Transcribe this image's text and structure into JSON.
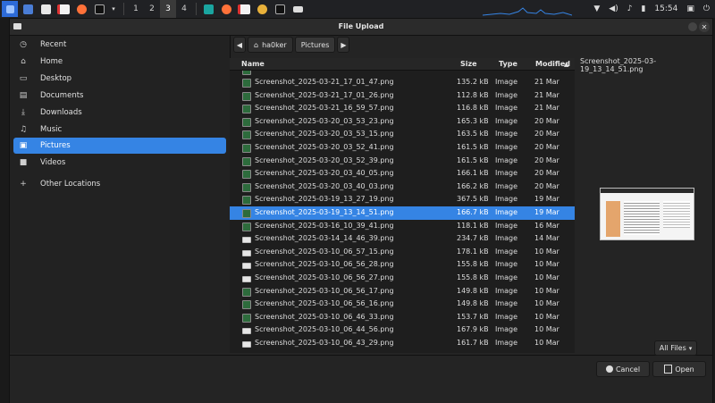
{
  "taskbar": {
    "workspaces": [
      "1",
      "2",
      "3",
      "4"
    ],
    "clock": "15:54"
  },
  "dialog": {
    "title": "File Upload"
  },
  "sidebar": {
    "items": [
      {
        "label": "Recent",
        "icon": "clock-icon"
      },
      {
        "label": "Home",
        "icon": "home-icon"
      },
      {
        "label": "Desktop",
        "icon": "desktop-icon"
      },
      {
        "label": "Documents",
        "icon": "document-icon"
      },
      {
        "label": "Downloads",
        "icon": "download-icon"
      },
      {
        "label": "Music",
        "icon": "music-icon"
      },
      {
        "label": "Pictures",
        "icon": "pictures-icon"
      },
      {
        "label": "Videos",
        "icon": "video-icon"
      },
      {
        "label": "Other Locations",
        "icon": "plus-icon"
      }
    ]
  },
  "path": {
    "home": "ha0ker",
    "current": "Pictures"
  },
  "columns": {
    "name": "Name",
    "size": "Size",
    "type": "Type",
    "modified": "Modified"
  },
  "files": [
    {
      "name": "Screenshot_2025-03-21_17_01_47.png",
      "size": "135.2 kB",
      "type": "Image",
      "modified": "21 Mar"
    },
    {
      "name": "Screenshot_2025-03-21_17_01_26.png",
      "size": "112.8 kB",
      "type": "Image",
      "modified": "21 Mar"
    },
    {
      "name": "Screenshot_2025-03-21_16_59_57.png",
      "size": "116.8 kB",
      "type": "Image",
      "modified": "21 Mar"
    },
    {
      "name": "Screenshot_2025-03-20_03_53_23.png",
      "size": "165.3 kB",
      "type": "Image",
      "modified": "20 Mar"
    },
    {
      "name": "Screenshot_2025-03-20_03_53_15.png",
      "size": "163.5 kB",
      "type": "Image",
      "modified": "20 Mar"
    },
    {
      "name": "Screenshot_2025-03-20_03_52_41.png",
      "size": "161.5 kB",
      "type": "Image",
      "modified": "20 Mar"
    },
    {
      "name": "Screenshot_2025-03-20_03_52_39.png",
      "size": "161.5 kB",
      "type": "Image",
      "modified": "20 Mar"
    },
    {
      "name": "Screenshot_2025-03-20_03_40_05.png",
      "size": "166.1 kB",
      "type": "Image",
      "modified": "20 Mar"
    },
    {
      "name": "Screenshot_2025-03-20_03_40_03.png",
      "size": "166.2 kB",
      "type": "Image",
      "modified": "20 Mar"
    },
    {
      "name": "Screenshot_2025-03-19_13_27_19.png",
      "size": "367.5 kB",
      "type": "Image",
      "modified": "19 Mar"
    },
    {
      "name": "Screenshot_2025-03-19_13_14_51.png",
      "size": "166.7 kB",
      "type": "Image",
      "modified": "19 Mar"
    },
    {
      "name": "Screenshot_2025-03-16_10_39_41.png",
      "size": "118.1 kB",
      "type": "Image",
      "modified": "16 Mar"
    },
    {
      "name": "Screenshot_2025-03-14_14_46_39.png",
      "size": "234.7 kB",
      "type": "Image",
      "modified": "14 Mar"
    },
    {
      "name": "Screenshot_2025-03-10_06_57_15.png",
      "size": "178.1 kB",
      "type": "Image",
      "modified": "10 Mar"
    },
    {
      "name": "Screenshot_2025-03-10_06_56_28.png",
      "size": "155.8 kB",
      "type": "Image",
      "modified": "10 Mar"
    },
    {
      "name": "Screenshot_2025-03-10_06_56_27.png",
      "size": "155.8 kB",
      "type": "Image",
      "modified": "10 Mar"
    },
    {
      "name": "Screenshot_2025-03-10_06_56_17.png",
      "size": "149.8 kB",
      "type": "Image",
      "modified": "10 Mar"
    },
    {
      "name": "Screenshot_2025-03-10_06_56_16.png",
      "size": "149.8 kB",
      "type": "Image",
      "modified": "10 Mar"
    },
    {
      "name": "Screenshot_2025-03-10_06_46_33.png",
      "size": "153.7 kB",
      "type": "Image",
      "modified": "10 Mar"
    },
    {
      "name": "Screenshot_2025-03-10_06_44_56.png",
      "size": "167.9 kB",
      "type": "Image",
      "modified": "10 Mar"
    },
    {
      "name": "Screenshot_2025-03-10_06_43_29.png",
      "size": "161.7 kB",
      "type": "Image",
      "modified": "10 Mar"
    }
  ],
  "preview": {
    "filename": "Screenshot_2025-03-19_13_14_51.png"
  },
  "footer": {
    "filter": "All Files",
    "cancel": "Cancel",
    "open": "Open"
  }
}
